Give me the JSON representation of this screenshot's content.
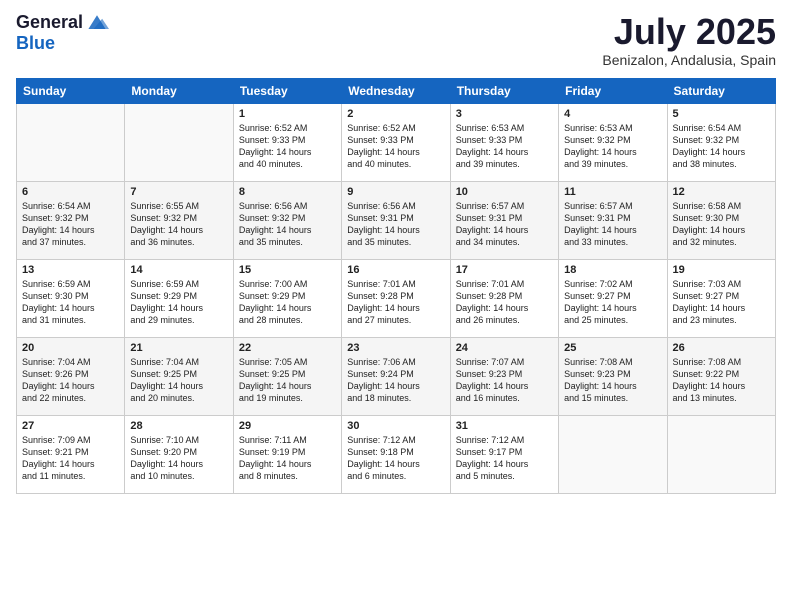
{
  "header": {
    "logo_line1": "General",
    "logo_line2": "Blue",
    "month": "July 2025",
    "location": "Benizalon, Andalusia, Spain"
  },
  "weekdays": [
    "Sunday",
    "Monday",
    "Tuesday",
    "Wednesday",
    "Thursday",
    "Friday",
    "Saturday"
  ],
  "weeks": [
    [
      {
        "day": "",
        "info": ""
      },
      {
        "day": "",
        "info": ""
      },
      {
        "day": "1",
        "info": "Sunrise: 6:52 AM\nSunset: 9:33 PM\nDaylight: 14 hours\nand 40 minutes."
      },
      {
        "day": "2",
        "info": "Sunrise: 6:52 AM\nSunset: 9:33 PM\nDaylight: 14 hours\nand 40 minutes."
      },
      {
        "day": "3",
        "info": "Sunrise: 6:53 AM\nSunset: 9:33 PM\nDaylight: 14 hours\nand 39 minutes."
      },
      {
        "day": "4",
        "info": "Sunrise: 6:53 AM\nSunset: 9:32 PM\nDaylight: 14 hours\nand 39 minutes."
      },
      {
        "day": "5",
        "info": "Sunrise: 6:54 AM\nSunset: 9:32 PM\nDaylight: 14 hours\nand 38 minutes."
      }
    ],
    [
      {
        "day": "6",
        "info": "Sunrise: 6:54 AM\nSunset: 9:32 PM\nDaylight: 14 hours\nand 37 minutes."
      },
      {
        "day": "7",
        "info": "Sunrise: 6:55 AM\nSunset: 9:32 PM\nDaylight: 14 hours\nand 36 minutes."
      },
      {
        "day": "8",
        "info": "Sunrise: 6:56 AM\nSunset: 9:32 PM\nDaylight: 14 hours\nand 35 minutes."
      },
      {
        "day": "9",
        "info": "Sunrise: 6:56 AM\nSunset: 9:31 PM\nDaylight: 14 hours\nand 35 minutes."
      },
      {
        "day": "10",
        "info": "Sunrise: 6:57 AM\nSunset: 9:31 PM\nDaylight: 14 hours\nand 34 minutes."
      },
      {
        "day": "11",
        "info": "Sunrise: 6:57 AM\nSunset: 9:31 PM\nDaylight: 14 hours\nand 33 minutes."
      },
      {
        "day": "12",
        "info": "Sunrise: 6:58 AM\nSunset: 9:30 PM\nDaylight: 14 hours\nand 32 minutes."
      }
    ],
    [
      {
        "day": "13",
        "info": "Sunrise: 6:59 AM\nSunset: 9:30 PM\nDaylight: 14 hours\nand 31 minutes."
      },
      {
        "day": "14",
        "info": "Sunrise: 6:59 AM\nSunset: 9:29 PM\nDaylight: 14 hours\nand 29 minutes."
      },
      {
        "day": "15",
        "info": "Sunrise: 7:00 AM\nSunset: 9:29 PM\nDaylight: 14 hours\nand 28 minutes."
      },
      {
        "day": "16",
        "info": "Sunrise: 7:01 AM\nSunset: 9:28 PM\nDaylight: 14 hours\nand 27 minutes."
      },
      {
        "day": "17",
        "info": "Sunrise: 7:01 AM\nSunset: 9:28 PM\nDaylight: 14 hours\nand 26 minutes."
      },
      {
        "day": "18",
        "info": "Sunrise: 7:02 AM\nSunset: 9:27 PM\nDaylight: 14 hours\nand 25 minutes."
      },
      {
        "day": "19",
        "info": "Sunrise: 7:03 AM\nSunset: 9:27 PM\nDaylight: 14 hours\nand 23 minutes."
      }
    ],
    [
      {
        "day": "20",
        "info": "Sunrise: 7:04 AM\nSunset: 9:26 PM\nDaylight: 14 hours\nand 22 minutes."
      },
      {
        "day": "21",
        "info": "Sunrise: 7:04 AM\nSunset: 9:25 PM\nDaylight: 14 hours\nand 20 minutes."
      },
      {
        "day": "22",
        "info": "Sunrise: 7:05 AM\nSunset: 9:25 PM\nDaylight: 14 hours\nand 19 minutes."
      },
      {
        "day": "23",
        "info": "Sunrise: 7:06 AM\nSunset: 9:24 PM\nDaylight: 14 hours\nand 18 minutes."
      },
      {
        "day": "24",
        "info": "Sunrise: 7:07 AM\nSunset: 9:23 PM\nDaylight: 14 hours\nand 16 minutes."
      },
      {
        "day": "25",
        "info": "Sunrise: 7:08 AM\nSunset: 9:23 PM\nDaylight: 14 hours\nand 15 minutes."
      },
      {
        "day": "26",
        "info": "Sunrise: 7:08 AM\nSunset: 9:22 PM\nDaylight: 14 hours\nand 13 minutes."
      }
    ],
    [
      {
        "day": "27",
        "info": "Sunrise: 7:09 AM\nSunset: 9:21 PM\nDaylight: 14 hours\nand 11 minutes."
      },
      {
        "day": "28",
        "info": "Sunrise: 7:10 AM\nSunset: 9:20 PM\nDaylight: 14 hours\nand 10 minutes."
      },
      {
        "day": "29",
        "info": "Sunrise: 7:11 AM\nSunset: 9:19 PM\nDaylight: 14 hours\nand 8 minutes."
      },
      {
        "day": "30",
        "info": "Sunrise: 7:12 AM\nSunset: 9:18 PM\nDaylight: 14 hours\nand 6 minutes."
      },
      {
        "day": "31",
        "info": "Sunrise: 7:12 AM\nSunset: 9:17 PM\nDaylight: 14 hours\nand 5 minutes."
      },
      {
        "day": "",
        "info": ""
      },
      {
        "day": "",
        "info": ""
      }
    ]
  ]
}
